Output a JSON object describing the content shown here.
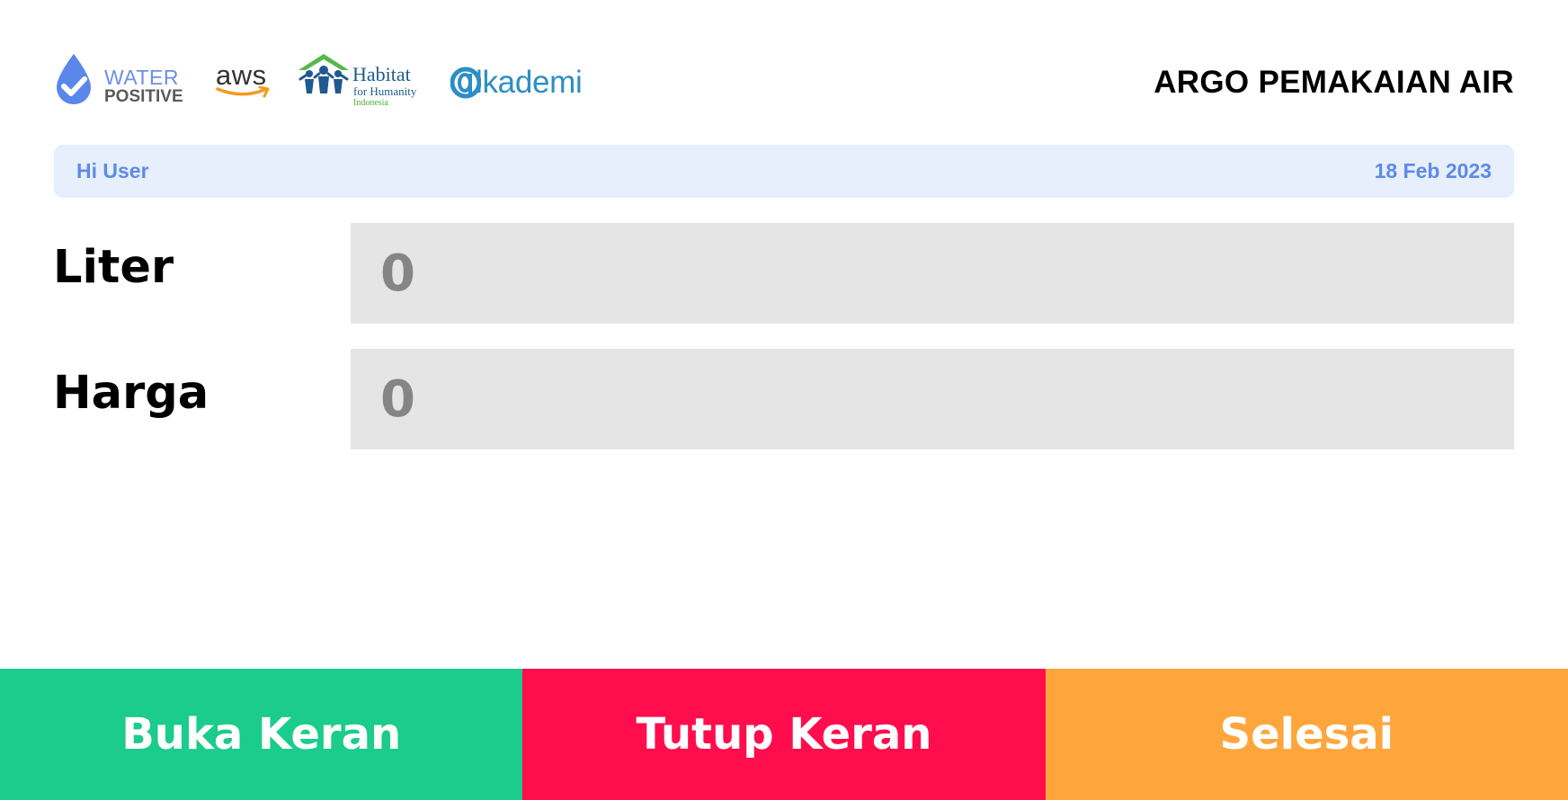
{
  "header": {
    "logos": {
      "water_positive": {
        "line1": "WATER",
        "line2": "POSITIVE",
        "icon": "water-drop-check-icon"
      },
      "aws": {
        "word": "aws",
        "icon": "amazon-smile-arrow-icon"
      },
      "habitat": {
        "line1": "Habitat",
        "line2": "for Humanity",
        "line3": "Indonesia",
        "icon": "house-people-icon"
      },
      "alkademi": {
        "word": "lkademi",
        "icon": "alkademi-a-icon"
      }
    },
    "title": "ARGO PEMAKAIAN AIR"
  },
  "greeting": {
    "text": "Hi User",
    "date": "18 Feb 2023"
  },
  "readouts": {
    "liter": {
      "label": "Liter",
      "value": "0"
    },
    "harga": {
      "label": "Harga",
      "value": "0"
    }
  },
  "actions": {
    "open": {
      "label": "Buka Keran",
      "color": "#1bcc8c"
    },
    "close": {
      "label": "Tutup Keran",
      "color": "#ff0d4d"
    },
    "finish": {
      "label": "Selesai",
      "color": "#fea63c"
    }
  },
  "colors": {
    "greeting_bg": "#e7eefc",
    "greeting_text": "#5d8ae8",
    "readout_bg": "#e5e5e5",
    "readout_value": "#858585"
  }
}
